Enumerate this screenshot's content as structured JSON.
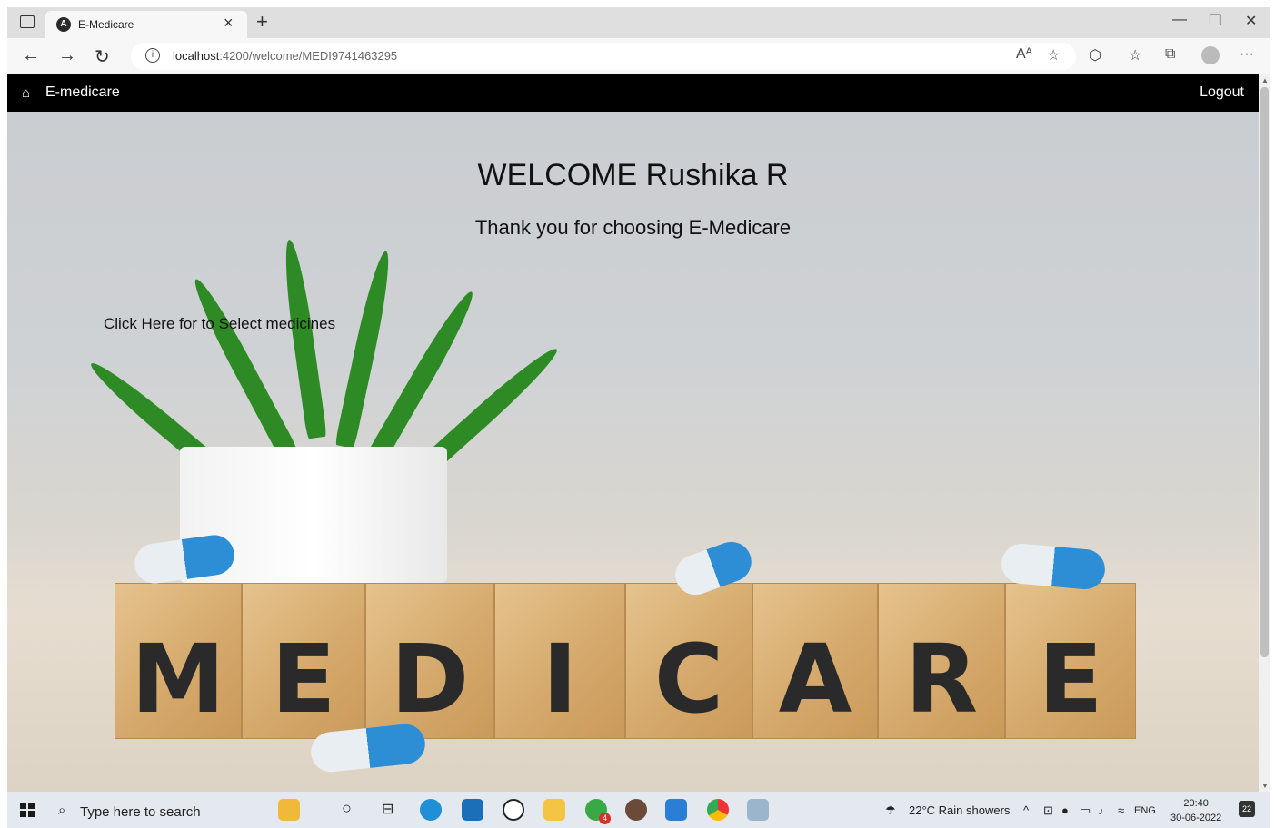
{
  "browser": {
    "tab_title": "E-Medicare",
    "url_host": "localhost",
    "url_path": ":4200/welcome/MEDI9741463295"
  },
  "navbar": {
    "brand": "E-medicare",
    "logout": "Logout"
  },
  "main": {
    "welcome": "WELCOME Rushika R",
    "thanks": "Thank you for choosing E-Medicare",
    "select_link": "Click Here for to Select medicines"
  },
  "blocks": [
    "M",
    "E",
    "D",
    "I",
    "C",
    "A",
    "R",
    "E"
  ],
  "taskbar": {
    "search_placeholder": "Type here to search",
    "weather": "22°C  Rain showers",
    "language": "ENG",
    "time": "20:40",
    "date": "30-06-2022",
    "notification_count": "22",
    "mail_badge": "4"
  },
  "colors": {
    "navbar_bg": "#000000",
    "pill_blue": "#2d8ed6",
    "leaf_green": "#2e8a24"
  }
}
